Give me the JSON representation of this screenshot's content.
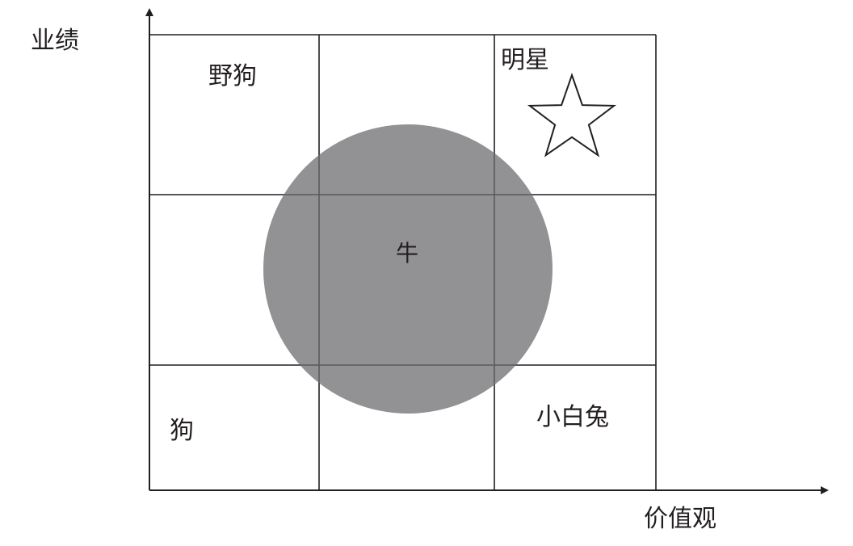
{
  "axes": {
    "y_label": "业绩",
    "x_label": "价值观"
  },
  "cells": {
    "top_left": "野狗",
    "top_right": "明星",
    "center": "牛",
    "bottom_left": "狗",
    "bottom_right": "小白兔"
  },
  "colors": {
    "line": "#231f20",
    "circle_fill": "#929194",
    "star_fill": "#ffffff"
  },
  "icons": {
    "star": "star-outline-icon"
  }
}
